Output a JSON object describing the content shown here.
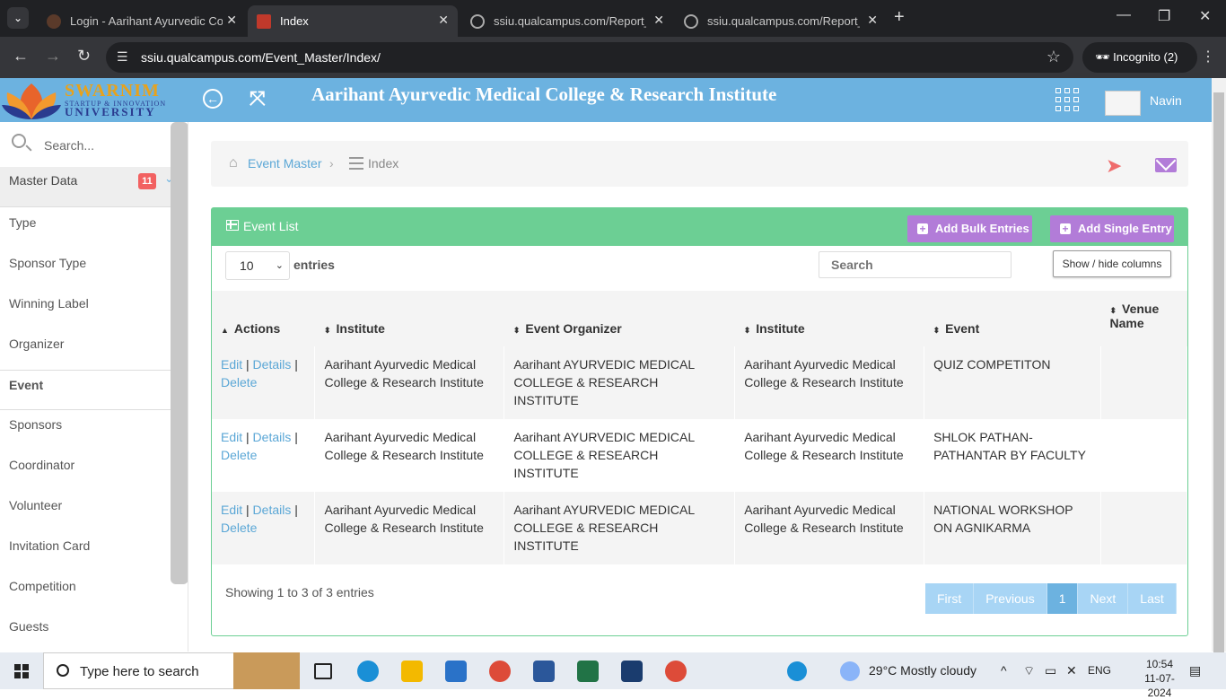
{
  "browser": {
    "tabs": [
      {
        "title": "Login - Aarihant Ayurvedic Colle",
        "active": false
      },
      {
        "title": "Index",
        "active": true
      },
      {
        "title": "ssiu.qualcampus.com/Report_Vi",
        "active": false
      },
      {
        "title": "ssiu.qualcampus.com/Report_Vi",
        "active": false
      }
    ],
    "url": "ssiu.qualcampus.com/Event_Master/Index/",
    "profile": "Incognito (2)"
  },
  "header": {
    "logo_name": "SWARNIM",
    "logo_sub": "STARTUP & INNOVATION",
    "logo_uni": "UNIVERSITY",
    "title": "Aarihant Ayurvedic Medical College & Research Institute",
    "user_name": "Navin"
  },
  "sidebar": {
    "search_placeholder": "Search...",
    "section": "Master Data",
    "section_badge": "11",
    "items": [
      {
        "label": "Type"
      },
      {
        "label": "Sponsor Type"
      },
      {
        "label": "Winning Label"
      },
      {
        "label": "Organizer"
      },
      {
        "label": "Event",
        "active": true
      },
      {
        "label": "Sponsors"
      },
      {
        "label": "Coordinator"
      },
      {
        "label": "Volunteer"
      },
      {
        "label": "Invitation Card"
      },
      {
        "label": "Competition"
      },
      {
        "label": "Guests"
      }
    ]
  },
  "breadcrumb": {
    "link": "Event Master",
    "current": "Index"
  },
  "panel": {
    "title": "Event List",
    "add_bulk": "Add Bulk Entries",
    "add_single": "Add Single Entry",
    "page_length": "10",
    "length_label": "entries",
    "search_placeholder": "Search",
    "colvis_label": "Show / hide columns"
  },
  "table": {
    "columns": [
      "Actions",
      "Institute",
      "Event Organizer",
      "Institute",
      "Event",
      "Venue Name"
    ],
    "action_links": {
      "edit": "Edit",
      "details": "Details",
      "delete": "Delete",
      "sep": "|"
    },
    "rows": [
      {
        "institute": "Aarihant Ayurvedic Medical College & Research Institute",
        "organizer": "Aarihant AYURVEDIC MEDICAL COLLEGE & RESEARCH INSTITUTE",
        "institute2": "Aarihant Ayurvedic Medical College & Research Institute",
        "event": "QUIZ COMPETITON",
        "venue": ""
      },
      {
        "institute": "Aarihant Ayurvedic Medical College & Research Institute",
        "organizer": "Aarihant AYURVEDIC MEDICAL COLLEGE & RESEARCH INSTITUTE",
        "institute2": "Aarihant Ayurvedic Medical College & Research Institute",
        "event": "SHLOK PATHAN-PATHANTAR BY FACULTY",
        "venue": ""
      },
      {
        "institute": "Aarihant Ayurvedic Medical College & Research Institute",
        "organizer": "Aarihant AYURVEDIC MEDICAL COLLEGE & RESEARCH INSTITUTE",
        "institute2": "Aarihant Ayurvedic Medical College & Research Institute",
        "event": "NATIONAL WORKSHOP ON AGNIKARMA",
        "venue": ""
      }
    ],
    "info": "Showing 1 to 3 of 3 entries",
    "pager": {
      "first": "First",
      "previous": "Previous",
      "current": "1",
      "next": "Next",
      "last": "Last"
    }
  },
  "taskbar": {
    "search_placeholder": "Type here to search",
    "weather": "29°C  Mostly cloudy",
    "lang": "ENG",
    "time": "10:54",
    "date": "11-07-2024"
  },
  "colors": {
    "header_blue": "#6cb2e0",
    "panel_green": "#6ccf94",
    "button_purple": "#b27cd8",
    "link_blue": "#5ba7d6",
    "badge_red": "#f26161"
  }
}
